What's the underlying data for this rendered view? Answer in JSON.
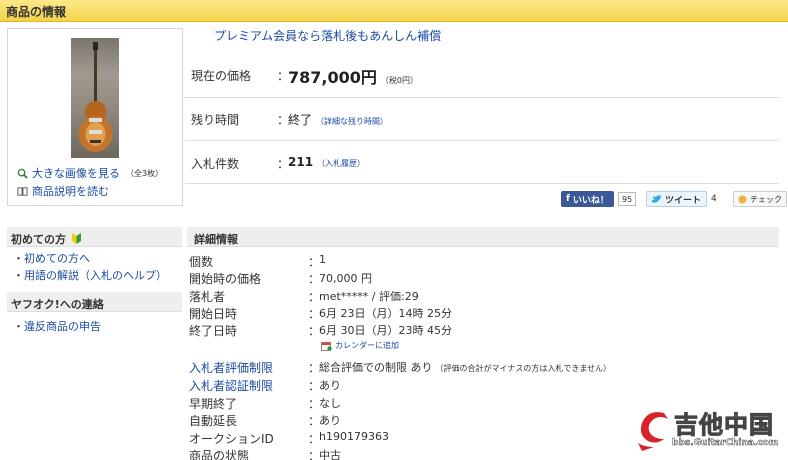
{
  "header": {
    "title": "商品の情報"
  },
  "image_box": {
    "view_large": "大きな画像を見る",
    "view_count": "（全3枚）",
    "read_desc": "商品説明を読む"
  },
  "promo": "プレミアム会員なら落札後もあんしん補償",
  "price_row": {
    "label": "現在の価格",
    "colon": "：",
    "price": "787,000円",
    "tax": "（税0円）"
  },
  "time_row": {
    "label": "残り時間",
    "colon": "：",
    "value": "終了",
    "link": "（詳細な残り時間）"
  },
  "bids_row": {
    "label": "入札件数",
    "colon": "：",
    "value": "211",
    "link": "（入札履歴）"
  },
  "social": {
    "like_label": "いいね！",
    "like_count": "95",
    "tweet_label": "ツイート",
    "tweet_count": "4",
    "check_label": "チェック"
  },
  "sidebar": {
    "sections": [
      {
        "title": "初めての方",
        "links": [
          "初めての方へ",
          "用語の解説（入札のヘルプ）"
        ]
      },
      {
        "title": "ヤフオク!への連絡",
        "links": [
          "違反商品の申告"
        ]
      }
    ]
  },
  "details": {
    "title": "詳細情報",
    "colon": "：",
    "rows": [
      {
        "key": "個数",
        "value": "1"
      },
      {
        "key": "開始時の価格",
        "value": "70,000 円"
      },
      {
        "key": "落札者",
        "value": "met***** / 評価:29"
      },
      {
        "key": "開始日時",
        "value": "6月 23日（月）14時 25分"
      },
      {
        "key": "終了日時",
        "value": "6月 30日（月）23時 45分"
      },
      {
        "key": "入札者評価制限",
        "value": "総合評価での制限 あり",
        "note": "（評価の合計がマイナスの方は入札できません）"
      },
      {
        "key": "入札者認証制限",
        "value": "あり"
      },
      {
        "key": "早期終了",
        "value": "なし"
      },
      {
        "key": "自動延長",
        "value": "あり"
      },
      {
        "key": "オークションID",
        "value": "h190179363"
      },
      {
        "key": "商品の状態",
        "value": "中古"
      }
    ],
    "calendar_link": "カレンダーに追加"
  },
  "watermark": {
    "cn": "吉他中国",
    "url": "bbs.GuitarChina.com"
  },
  "colors": {
    "header_bg": "#f4d24a",
    "link": "#1a4aa5",
    "facebook": "#3b5998"
  }
}
